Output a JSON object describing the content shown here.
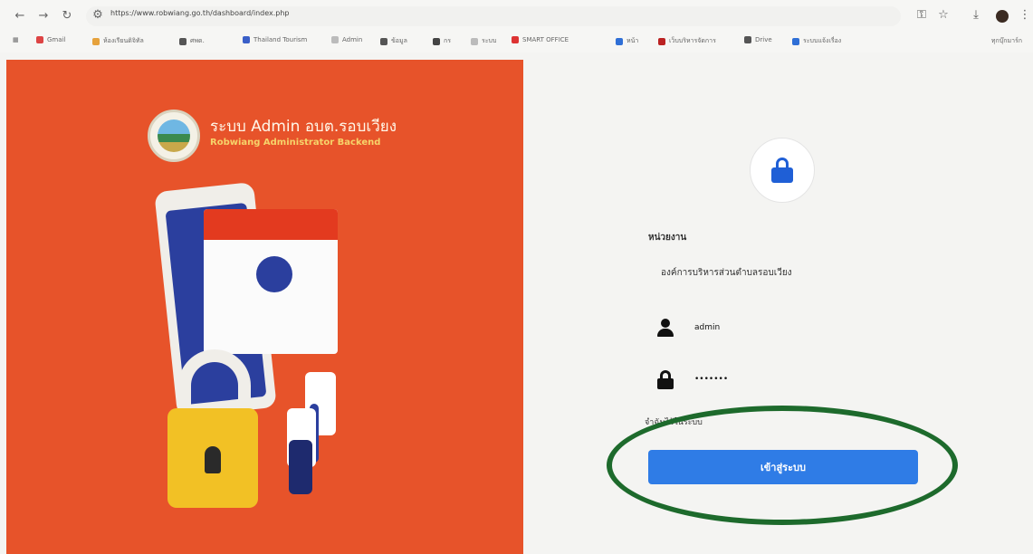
{
  "browser": {
    "back_icon": "arrow-left-icon",
    "forward_icon": "arrow-right-icon",
    "reload_icon": "reload-icon",
    "url": "https://www.robwiang.go.th/dashboard/index.php",
    "bookmarks": [
      "Gmail",
      "ห้องเรียนดิจิทัล",
      "ศพด.",
      "Thailand Tourism",
      "Admin",
      "ข้อมูล",
      "กร",
      "ระบบ",
      "SMART OFFICE",
      "หน้า",
      "เว็บบริหารจัดการ",
      "Drive",
      "ระบบแจ้งเรื่อง"
    ],
    "bookmarks_right": "ทุกบุ๊กมาร์ก"
  },
  "hero": {
    "title": "ระบบ Admin อบต.รอบเวียง",
    "subtitle": "Robwiang Administrator Backend",
    "colors": {
      "background": "#e7532a",
      "accent": "#f6d46a"
    }
  },
  "login": {
    "unit_label": "หน่วยงาน",
    "unit_value": "องค์การบริหารส่วนตำบลรอบเวียง",
    "username_value": "admin",
    "password_value": "•••••••",
    "remember_label": "จำฉันไว้ในระบบ",
    "submit_label": "เข้าสู่ระบบ",
    "colors": {
      "button": "#2f7ce6",
      "lock": "#1f5fd6",
      "highlight": "#1d6a2c"
    }
  }
}
